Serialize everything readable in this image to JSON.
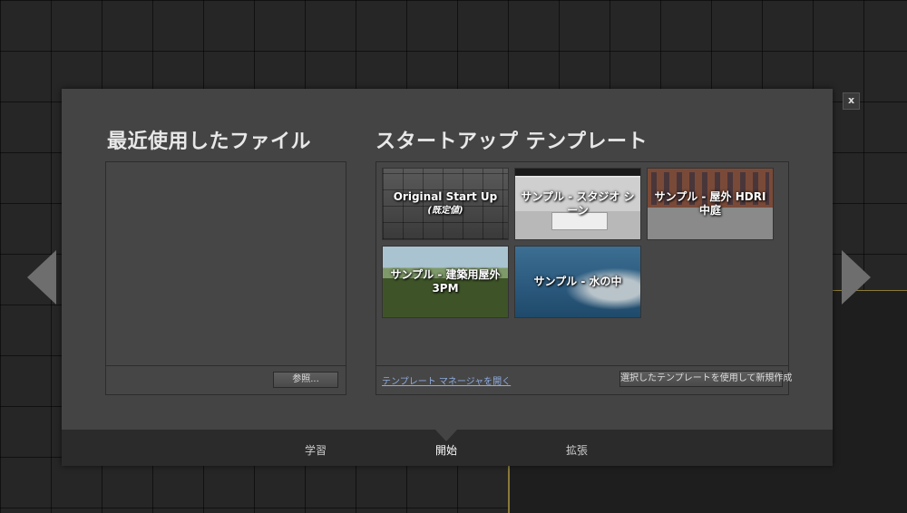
{
  "dialog": {
    "close_label": "x"
  },
  "recent": {
    "title": "最近使用したファイル",
    "browse_label": "参照..."
  },
  "templates": {
    "title": "スタートアップ テンプレート",
    "items": [
      {
        "label": "Original Start Up",
        "sub": "(既定値)"
      },
      {
        "label": "サンプル - スタジオ シーン"
      },
      {
        "label": "サンプル - 屋外 HDRI 中庭"
      },
      {
        "label": "サンプル - 建築用屋外 3PM"
      },
      {
        "label": "サンプル - 水の中"
      }
    ],
    "manager_link": "テンプレート マネージャを開く",
    "create_label": "選択したテンプレートを使用して新規作成"
  },
  "tabs": [
    {
      "label": "学習"
    },
    {
      "label": "開始"
    },
    {
      "label": "拡張"
    }
  ]
}
